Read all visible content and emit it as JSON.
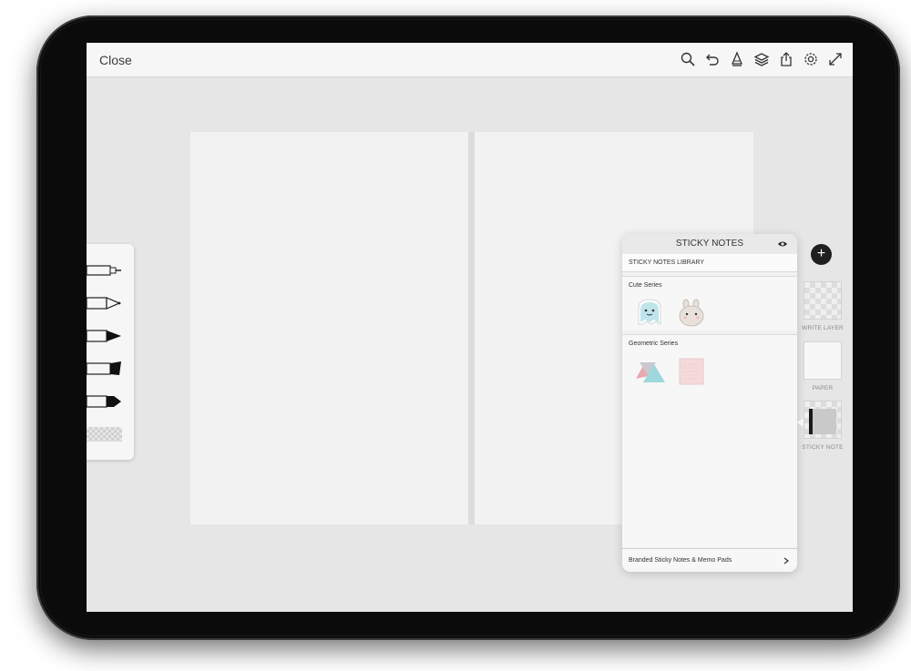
{
  "topbar": {
    "close_label": "Close",
    "icons": [
      "search-icon",
      "undo-icon",
      "pen-nib-icon",
      "layers-icon",
      "share-icon",
      "settings-icon",
      "expand-icon"
    ]
  },
  "pen_tray": {
    "tools": [
      "fineliner-pen",
      "ballpoint-pen",
      "brush-pen",
      "marker-pen",
      "calligraphy-pen"
    ],
    "eraser": "eraser-swatch"
  },
  "sticky_notes": {
    "title": "STICKY NOTES",
    "library_label": "STICKY NOTES LIBRARY",
    "sections": [
      {
        "title": "Cute Series",
        "items": [
          "ghost-sticker",
          "bunny-sticker"
        ]
      },
      {
        "title": "Geometric Series",
        "items": [
          "triangle-notes",
          "grid-note"
        ]
      }
    ],
    "footer_label": "Branded Sticky Notes & Memo Pads"
  },
  "layers": {
    "add_label": "+",
    "items": [
      {
        "label": "WRITE LAYER"
      },
      {
        "label": "PAPER"
      },
      {
        "label": "STICKY NOTE"
      }
    ]
  },
  "colors": {
    "screen_bg": "#e6e6e7",
    "page_bg": "#f2f2f2",
    "toolbar_bg": "#f6f6f6",
    "accent_dark": "#1f1f1f"
  }
}
